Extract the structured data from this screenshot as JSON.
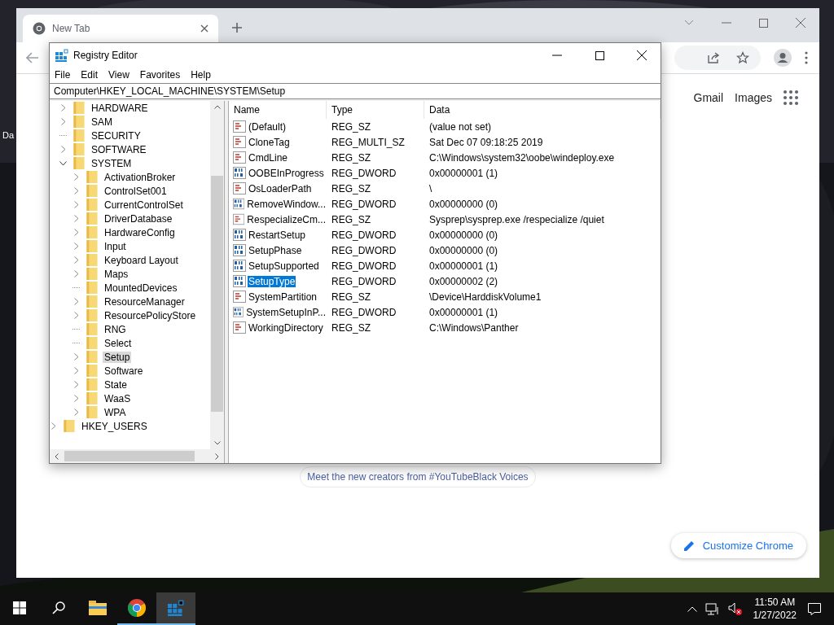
{
  "desktop": {
    "icon_labels": [
      "Da"
    ]
  },
  "browser": {
    "tab": {
      "title": "New Tab",
      "selected": true
    },
    "links": [
      "Gmail",
      "Images"
    ],
    "promo": "Meet the new creators from #YouTubeBlack Voices",
    "customize_button": "Customize Chrome"
  },
  "regedit": {
    "title": "Registry Editor",
    "menu": [
      "File",
      "Edit",
      "View",
      "Favorites",
      "Help"
    ],
    "address": "Computer\\HKEY_LOCAL_MACHINE\\SYSTEM\\Setup",
    "tree": [
      {
        "label": "HARDWARE",
        "expandable": true,
        "expanded": false,
        "selected": false
      },
      {
        "label": "SAM",
        "expandable": true,
        "expanded": false,
        "selected": false
      },
      {
        "label": "SECURITY",
        "expandable": false,
        "selected": false
      },
      {
        "label": "SOFTWARE",
        "expandable": true,
        "expanded": false,
        "selected": false
      },
      {
        "label": "SYSTEM",
        "expandable": true,
        "expanded": true,
        "selected": false,
        "children": [
          {
            "label": "ActivationBroker",
            "expandable": true,
            "expanded": false,
            "selected": false
          },
          {
            "label": "ControlSet001",
            "expandable": true,
            "expanded": false,
            "selected": false
          },
          {
            "label": "CurrentControlSet",
            "expandable": true,
            "expanded": false,
            "selected": false
          },
          {
            "label": "DriverDatabase",
            "expandable": true,
            "expanded": false,
            "selected": false
          },
          {
            "label": "HardwareConfig",
            "expandable": true,
            "expanded": false,
            "selected": false
          },
          {
            "label": "Input",
            "expandable": true,
            "expanded": false,
            "selected": false
          },
          {
            "label": "Keyboard Layout",
            "expandable": true,
            "expanded": false,
            "selected": false
          },
          {
            "label": "Maps",
            "expandable": true,
            "expanded": false,
            "selected": false
          },
          {
            "label": "MountedDevices",
            "expandable": false,
            "selected": false
          },
          {
            "label": "ResourceManager",
            "expandable": true,
            "expanded": false,
            "selected": false
          },
          {
            "label": "ResourcePolicyStore",
            "expandable": true,
            "expanded": false,
            "selected": false
          },
          {
            "label": "RNG",
            "expandable": false,
            "selected": false
          },
          {
            "label": "Select",
            "expandable": false,
            "selected": false
          },
          {
            "label": "Setup",
            "expandable": true,
            "expanded": false,
            "selected": true
          },
          {
            "label": "Software",
            "expandable": true,
            "expanded": false,
            "selected": false
          },
          {
            "label": "State",
            "expandable": true,
            "expanded": false,
            "selected": false
          },
          {
            "label": "WaaS",
            "expandable": true,
            "expanded": false,
            "selected": false
          },
          {
            "label": "WPA",
            "expandable": true,
            "expanded": false,
            "selected": false
          }
        ]
      }
    ],
    "tree_after": [
      {
        "label": "HKEY_USERS",
        "expandable": true,
        "expanded": false,
        "selected": false
      }
    ],
    "columns": [
      "Name",
      "Type",
      "Data"
    ],
    "values": [
      {
        "kind": "string",
        "name": "(Default)",
        "type": "REG_SZ",
        "data": "(value not set)",
        "selected": false
      },
      {
        "kind": "string",
        "name": "CloneTag",
        "type": "REG_MULTI_SZ",
        "data": "Sat Dec 07 09:18:25 2019",
        "selected": false
      },
      {
        "kind": "string",
        "name": "CmdLine",
        "type": "REG_SZ",
        "data": "C:\\Windows\\system32\\oobe\\windeploy.exe",
        "selected": false
      },
      {
        "kind": "binary",
        "name": "OOBEInProgress",
        "type": "REG_DWORD",
        "data": "0x00000001 (1)",
        "selected": false
      },
      {
        "kind": "string",
        "name": "OsLoaderPath",
        "type": "REG_SZ",
        "data": "\\",
        "selected": false
      },
      {
        "kind": "binary",
        "name": "RemoveWindow...",
        "type": "REG_DWORD",
        "data": "0x00000000 (0)",
        "selected": false
      },
      {
        "kind": "string",
        "name": "RespecializeCm...",
        "type": "REG_SZ",
        "data": "Sysprep\\sysprep.exe /respecialize /quiet",
        "selected": false
      },
      {
        "kind": "binary",
        "name": "RestartSetup",
        "type": "REG_DWORD",
        "data": "0x00000000 (0)",
        "selected": false
      },
      {
        "kind": "binary",
        "name": "SetupPhase",
        "type": "REG_DWORD",
        "data": "0x00000000 (0)",
        "selected": false
      },
      {
        "kind": "binary",
        "name": "SetupSupported",
        "type": "REG_DWORD",
        "data": "0x00000001 (1)",
        "selected": false
      },
      {
        "kind": "binary",
        "name": "SetupType",
        "type": "REG_DWORD",
        "data": "0x00000002 (2)",
        "selected": true
      },
      {
        "kind": "string",
        "name": "SystemPartition",
        "type": "REG_SZ",
        "data": "\\Device\\HarddiskVolume1",
        "selected": false
      },
      {
        "kind": "binary",
        "name": "SystemSetupInP...",
        "type": "REG_DWORD",
        "data": "0x00000001 (1)",
        "selected": false
      },
      {
        "kind": "string",
        "name": "WorkingDirectory",
        "type": "REG_SZ",
        "data": "C:\\Windows\\Panther",
        "selected": false
      }
    ]
  },
  "taskbar": {
    "apps": [
      {
        "kind": "explorer",
        "running": false,
        "active": false
      },
      {
        "kind": "chrome",
        "running": true,
        "active": false
      },
      {
        "kind": "regedit",
        "running": true,
        "active": true
      }
    ],
    "time": "11:50 AM",
    "date": "1/27/2022"
  }
}
